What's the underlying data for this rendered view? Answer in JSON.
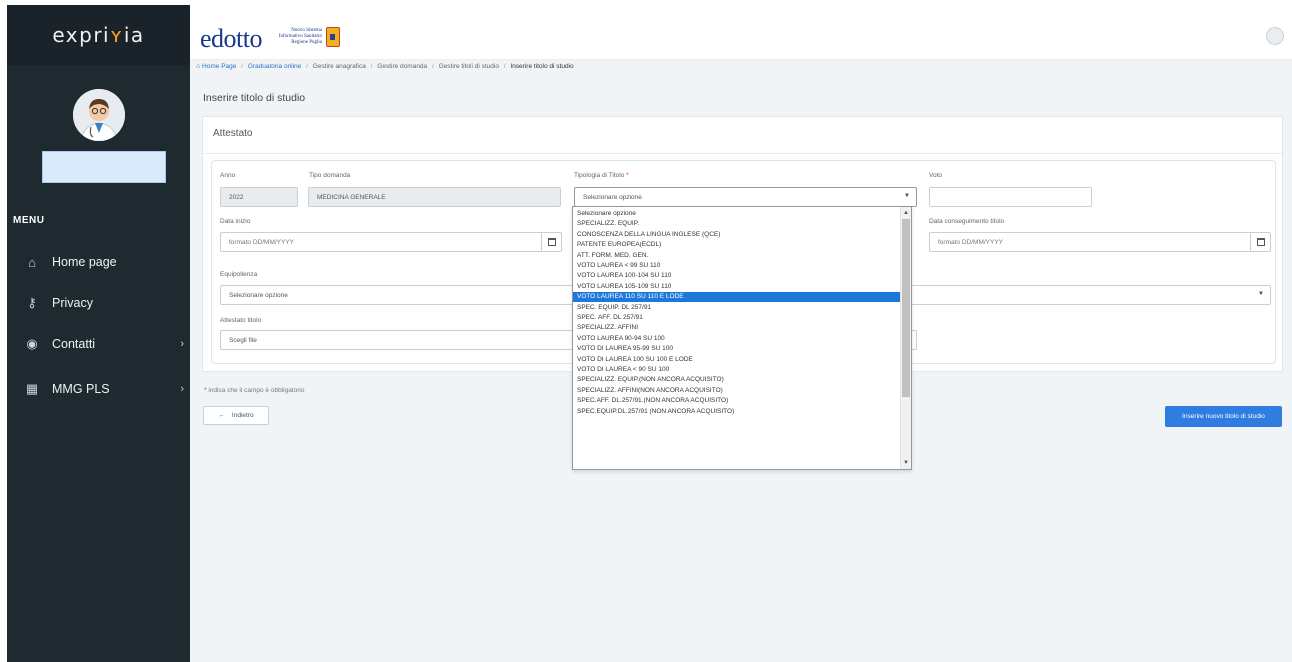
{
  "sidebar": {
    "logo": {
      "part1": "expri",
      "part2": "ʏ",
      "part3": "ia"
    },
    "menu_title": "MENU",
    "items": [
      {
        "label": "Home page",
        "icon": "home-icon",
        "glyph": "⌂"
      },
      {
        "label": "Privacy",
        "icon": "key-icon",
        "glyph": "⚷"
      },
      {
        "label": "Contatti",
        "icon": "user-circle-icon",
        "glyph": "◉"
      },
      {
        "label": "MMG PLS",
        "icon": "grid-icon",
        "glyph": "▦"
      }
    ],
    "chevron": "›"
  },
  "header": {
    "brand": "edotto",
    "brand_sub": "Nuovo Sistema Informativo Sanitario Regione Puglia"
  },
  "breadcrumb": {
    "home": "Home Page",
    "graduatoria": "Graduatoria online",
    "anagrafica": "Gestire anagrafica",
    "domanda": "Gestire domanda",
    "titoli": "Gestire titoli di studio",
    "current": "Inserire titolo di studio",
    "separator": "/"
  },
  "page": {
    "title": "Inserire titolo di studio"
  },
  "card": {
    "title": "Attestato"
  },
  "form": {
    "anno": {
      "label": "Anno",
      "value": "2022"
    },
    "tipo_domanda": {
      "label": "Tipo domanda",
      "value": "MEDICINA GENERALE"
    },
    "tipologia_titolo": {
      "label": "Tipologia di Titolo",
      "required_mark": "*",
      "value": "Selezionare opzione"
    },
    "voto": {
      "label": "Voto",
      "value": ""
    },
    "data_inizio": {
      "label": "Data inizio",
      "placeholder": "formato DD/MM/YYYY"
    },
    "data_conseguimento": {
      "label": "Data conseguimento titolo",
      "placeholder": "formato DD/MM/YYYY"
    },
    "equipollenza": {
      "label": "Equipollenza",
      "value": "Selezionare opzione"
    },
    "attestato_titolo": {
      "label": "Attestato titolo",
      "value": "Scegli file"
    }
  },
  "required_note": {
    "mark": "*",
    "text": "indica che il campo è obbligatorio"
  },
  "buttons": {
    "back_arrow": "←",
    "back": "Indietro",
    "submit": "Inserire nuovo titolo di studio"
  },
  "dropdown": {
    "selected_index": 10,
    "options": [
      "Selezionare opzione",
      "SPECIALIZZ. EQUIP.",
      "CONOSCENZA DELLA LINGUA INGLESE (QCE)",
      "PATENTE EUROPEA(ECDL)",
      "ATT. FORM. MED. GEN.",
      "VOTO LAUREA < 99 SU 110",
      "VOTO LAUREA 100-104 SU 110",
      "VOTO LAUREA 105-109 SU 110",
      "VOTO LAUREA 110 SU 110 E LODE",
      "SPEC. EQUIP. DL 257/91",
      "SPEC. AFF. DL 257/91",
      "SPECIALIZZ. AFFINI",
      "VOTO LAUREA 90-94 SU 100",
      "VOTO DI LAUREA 95-99 SU 100",
      "VOTO DI LAUREA 100 SU 100 E LODE",
      "VOTO DI LAUREA < 90 SU 100",
      "SPECIALIZZ. EQUIP.(NON ANCORA ACQUISITO)",
      "SPECIALIZZ. AFFINI(NON ANCORA ACQUISITO)",
      "SPEC.AFF. DL.257/91.(NON ANCORA ACQUISITO)",
      "SPEC.EQUIP.DL.257/91 (NON ANCORA ACQUISITO)"
    ]
  },
  "colors": {
    "sidebar": "#1e2930",
    "accent": "#2f7de1",
    "selected_option": "#1e78dc",
    "brand": "#173a8a"
  }
}
